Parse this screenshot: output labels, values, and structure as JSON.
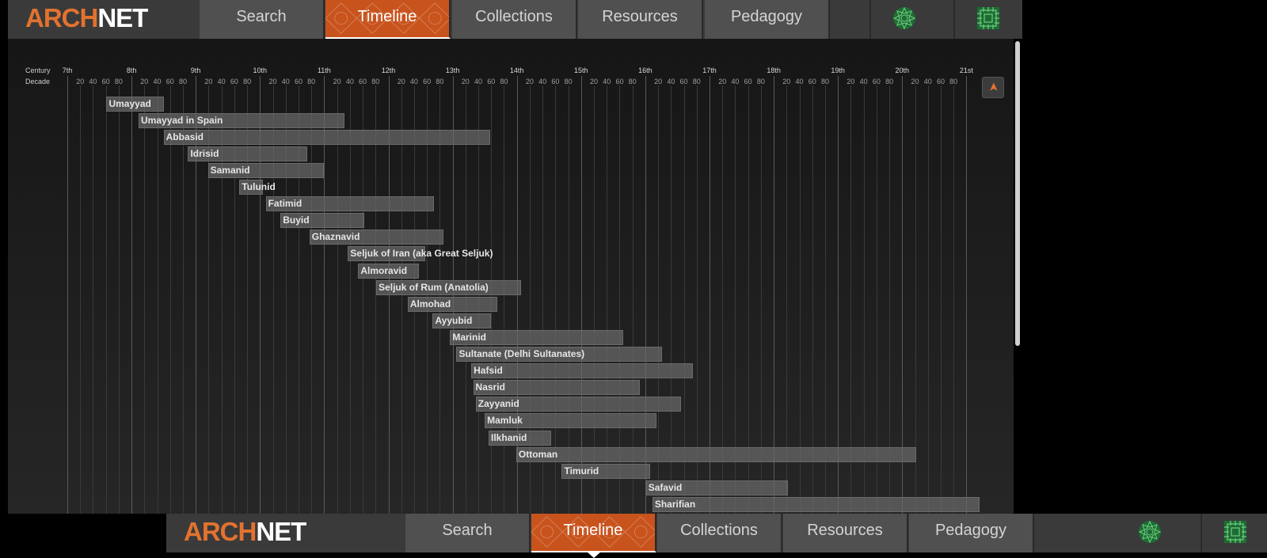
{
  "brand": {
    "part1": "ARCH",
    "part2": "NET"
  },
  "nav": {
    "tabs": [
      {
        "label": "Search"
      },
      {
        "label": "Timeline",
        "active": true
      },
      {
        "label": "Collections"
      },
      {
        "label": "Resources"
      },
      {
        "label": "Pedagogy"
      }
    ],
    "icons": [
      "rosette-icon",
      "lattice-icon"
    ]
  },
  "timeline": {
    "century_label": "Century",
    "decade_label": "Decade",
    "centuries": [
      "7th",
      "8th",
      "9th",
      "10th",
      "11th",
      "12th",
      "13th",
      "14th",
      "15th",
      "16th",
      "17th",
      "18th",
      "19th",
      "20th",
      "21st"
    ],
    "decade_ticks": [
      "20",
      "40",
      "60",
      "80"
    ],
    "scroll_up_glyph": "➤",
    "dynasties": [
      {
        "name": "Umayyad",
        "start": 661,
        "end": 750
      },
      {
        "name": "Umayyad in Spain",
        "start": 711,
        "end": 1031
      },
      {
        "name": "Abbasid",
        "start": 750,
        "end": 1258
      },
      {
        "name": "Idrisid",
        "start": 788,
        "end": 974
      },
      {
        "name": "Samanid",
        "start": 819,
        "end": 1000
      },
      {
        "name": "Tulunid",
        "start": 868,
        "end": 905
      },
      {
        "name": "Fatimid",
        "start": 909,
        "end": 1171
      },
      {
        "name": "Buyid",
        "start": 932,
        "end": 1062
      },
      {
        "name": "Ghaznavid",
        "start": 977,
        "end": 1186
      },
      {
        "name": "Seljuk of Iran (aka Great Seljuk)",
        "start": 1037,
        "end": 1157
      },
      {
        "name": "Almoravid",
        "start": 1053,
        "end": 1147
      },
      {
        "name": "Seljuk of Rum (Anatolia)",
        "start": 1081,
        "end": 1307
      },
      {
        "name": "Almohad",
        "start": 1130,
        "end": 1269
      },
      {
        "name": "Ayyubid",
        "start": 1169,
        "end": 1260
      },
      {
        "name": "Marinid",
        "start": 1196,
        "end": 1465
      },
      {
        "name": "Sultanate (Delhi Sultanates)",
        "start": 1206,
        "end": 1526
      },
      {
        "name": "Hafsid",
        "start": 1229,
        "end": 1574
      },
      {
        "name": "Nasrid",
        "start": 1232,
        "end": 1492
      },
      {
        "name": "Zayyanid",
        "start": 1236,
        "end": 1556
      },
      {
        "name": "Mamluk",
        "start": 1250,
        "end": 1517
      },
      {
        "name": "Ilkhanid",
        "start": 1256,
        "end": 1353
      },
      {
        "name": "Ottoman",
        "start": 1299,
        "end": 1922
      },
      {
        "name": "Timurid",
        "start": 1370,
        "end": 1507
      },
      {
        "name": "Safavid",
        "start": 1501,
        "end": 1722
      },
      {
        "name": "Sharifian",
        "start": 1511,
        "end": 2020
      }
    ]
  }
}
